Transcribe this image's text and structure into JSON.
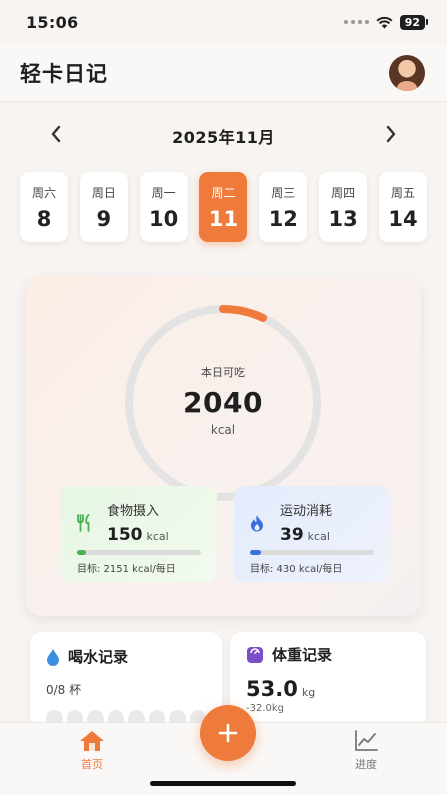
{
  "status": {
    "time": "15:06",
    "battery": "92"
  },
  "header": {
    "title": "轻卡日记"
  },
  "calendar": {
    "month": "2025年11月",
    "days": [
      {
        "weekday": "周六",
        "date": "8"
      },
      {
        "weekday": "周日",
        "date": "9"
      },
      {
        "weekday": "周一",
        "date": "10"
      },
      {
        "weekday": "周二",
        "date": "11",
        "selected": true
      },
      {
        "weekday": "周三",
        "date": "12"
      },
      {
        "weekday": "周四",
        "date": "13"
      },
      {
        "weekday": "周五",
        "date": "14"
      }
    ]
  },
  "summary": {
    "label": "本日可吃",
    "value": "2040",
    "unit": "kcal",
    "food": {
      "name": "食物摄入",
      "value": "150",
      "unit": "kcal",
      "goal": "目标: 2151 kcal/每日",
      "progress": 0.07
    },
    "burn": {
      "name": "运动消耗",
      "value": "39",
      "unit": "kcal",
      "goal": "目标: 430 kcal/每日",
      "progress": 0.09
    }
  },
  "water": {
    "title": "喝水记录",
    "count": "0/8 杯",
    "cups_filled": 0,
    "cups_total": 8
  },
  "weight": {
    "title": "体重记录",
    "value": "53.0",
    "unit": "kg",
    "change": "-32.0kg"
  },
  "tabs": {
    "home": "首页",
    "progress": "进度"
  },
  "colors": {
    "accent": "#ee7a3c",
    "food": "#4caf50",
    "burn": "#3b6fe0",
    "water": "#3b8fe0",
    "weight": "#7b4fc9"
  }
}
